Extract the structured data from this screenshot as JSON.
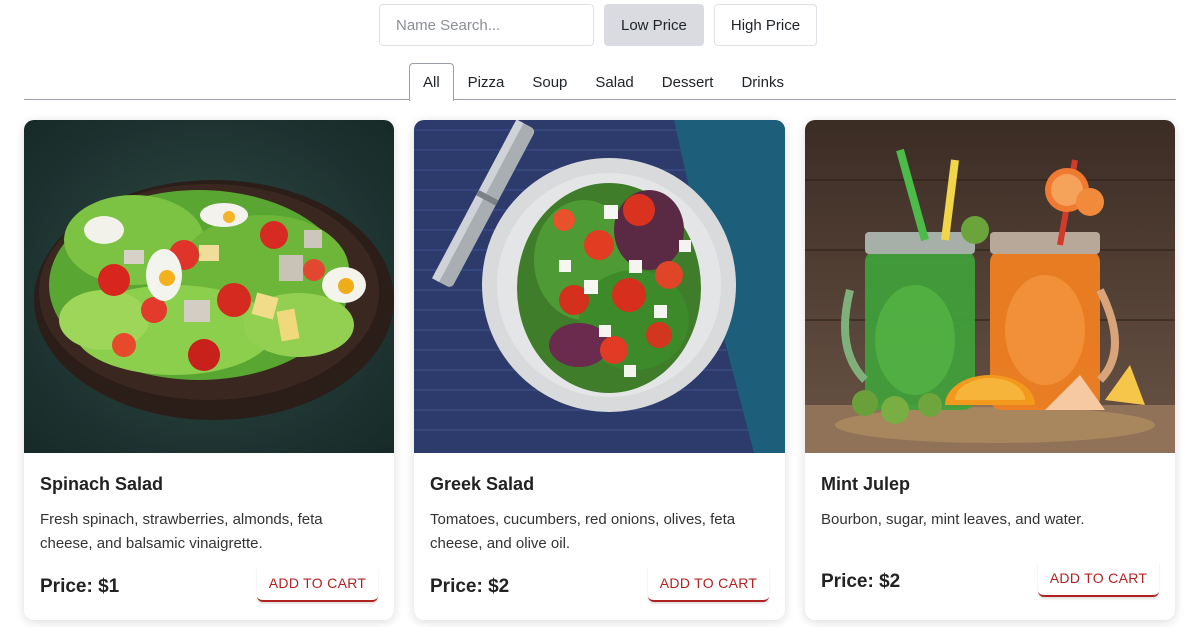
{
  "search": {
    "placeholder": "Name Search...",
    "value": ""
  },
  "price_filters": {
    "low_label": "Low Price",
    "high_label": "High Price"
  },
  "tabs": [
    {
      "label": "All",
      "active": true
    },
    {
      "label": "Pizza"
    },
    {
      "label": "Soup"
    },
    {
      "label": "Salad"
    },
    {
      "label": "Dessert"
    },
    {
      "label": "Drinks"
    }
  ],
  "price_prefix": "Price:",
  "cart_label": "ADD TO CART",
  "accent_color": "#b12222",
  "cards": [
    {
      "title": "Spinach Salad",
      "description": "Fresh spinach, strawberries, almonds, feta cheese, and balsamic vinaigrette.",
      "price": "$1",
      "image": "salad-plate-photo"
    },
    {
      "title": "Greek Salad",
      "description": "Tomatoes, cucumbers, red onions, olives, feta cheese, and olive oil.",
      "price": "$2",
      "image": "greek-salad-photo"
    },
    {
      "title": "Mint Julep",
      "description": "Bourbon, sugar, mint leaves, and water.",
      "price": "$2",
      "image": "drinks-jars-photo"
    }
  ]
}
